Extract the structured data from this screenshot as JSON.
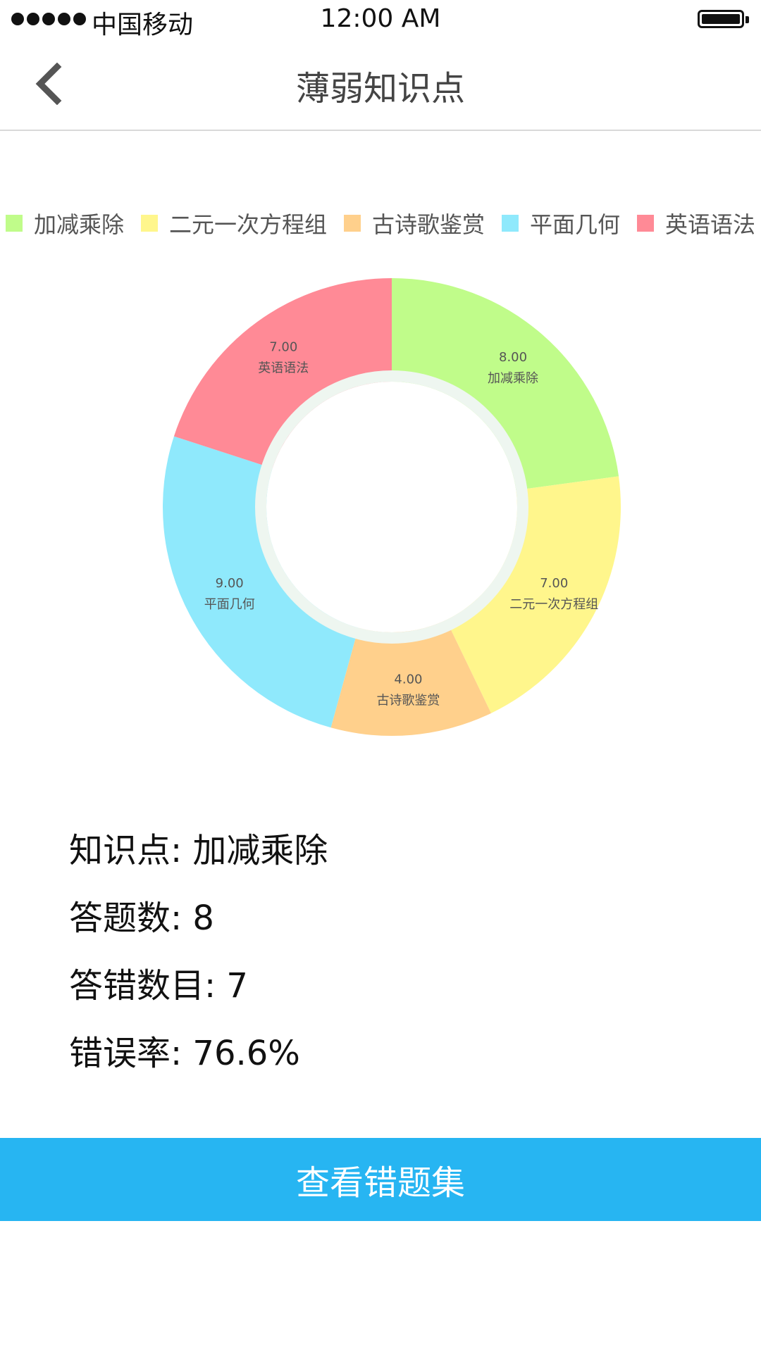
{
  "status_bar": {
    "carrier": "中国移动",
    "time": "12:00 AM",
    "signal_dots": 5
  },
  "nav": {
    "title": "薄弱知识点",
    "back_icon": "chevron-left-icon"
  },
  "chart_data": {
    "type": "pie",
    "donut": true,
    "legend_position": "top",
    "categories": [
      "加减乘除",
      "二元一次方程组",
      "古诗歌鉴赏",
      "平面几何",
      "英语语法"
    ],
    "values": [
      8,
      7,
      4,
      9,
      7
    ],
    "value_labels": [
      "8.00",
      "7.00",
      "4.00",
      "9.00",
      "7.00"
    ],
    "colors": [
      "#c0fc8a",
      "#fff68c",
      "#ffd08c",
      "#8fe9fc",
      "#ff8a96"
    ]
  },
  "info": {
    "knowledge_point": "知识点: 加减乘除",
    "answer_count": "答题数: 8",
    "wrong_count": "答错数目: 7",
    "error_rate": "错误率: 76.6%"
  },
  "actions": {
    "view_mistakes": "查看错题集"
  }
}
